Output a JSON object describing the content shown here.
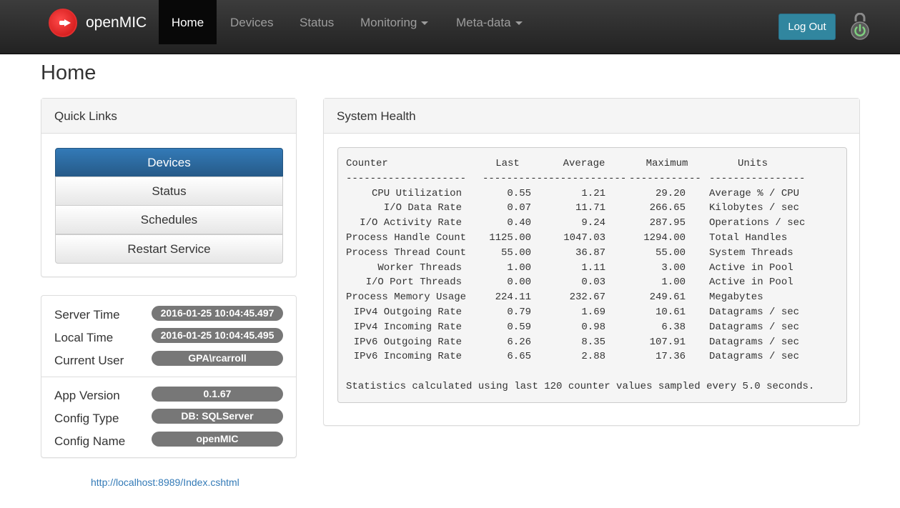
{
  "nav": {
    "brand": "openMIC",
    "items": [
      "Home",
      "Devices",
      "Status",
      "Monitoring",
      "Meta-data"
    ],
    "logout": "Log Out"
  },
  "page": {
    "title": "Home"
  },
  "quick_links": {
    "title": "Quick Links",
    "buttons": [
      "Devices",
      "Status",
      "Schedules",
      "Restart Service"
    ]
  },
  "info": {
    "server_time": {
      "label": "Server Time",
      "value": "2016-01-25 10:04:45.497"
    },
    "local_time": {
      "label": "Local Time",
      "value": "2016-01-25 10:04:45.495"
    },
    "current_user": {
      "label": "Current User",
      "value": "GPA\\rcarroll"
    },
    "app_version": {
      "label": "App Version",
      "value": "0.1.67"
    },
    "config_type": {
      "label": "Config Type",
      "value": "DB: SQLServer"
    },
    "config_name": {
      "label": "Config Name",
      "value": "openMIC"
    }
  },
  "footer": {
    "link": "http://localhost:8989/Index.cshtml"
  },
  "health": {
    "title": "System Health",
    "headers": [
      "Counter",
      "Last",
      "Average",
      "Maximum",
      "Units"
    ],
    "separators": [
      "--------------------",
      "------------",
      "-------------",
      "------------",
      "----------------"
    ],
    "rows": [
      [
        "CPU Utilization",
        "0.55",
        "1.21",
        "29.20",
        "Average % / CPU"
      ],
      [
        "I/O Data Rate",
        "0.07",
        "11.71",
        "266.65",
        "Kilobytes / sec"
      ],
      [
        "I/O Activity Rate",
        "0.40",
        "9.24",
        "287.95",
        "Operations / sec"
      ],
      [
        "Process Handle Count",
        "1125.00",
        "1047.03",
        "1294.00",
        "Total Handles"
      ],
      [
        "Process Thread Count",
        "55.00",
        "36.87",
        "55.00",
        "System Threads"
      ],
      [
        "Worker Threads",
        "1.00",
        "1.11",
        "3.00",
        "Active in Pool"
      ],
      [
        "I/O Port Threads",
        "0.00",
        "0.03",
        "1.00",
        "Active in Pool"
      ],
      [
        "Process Memory Usage",
        "224.11",
        "232.67",
        "249.61",
        "Megabytes"
      ],
      [
        "IPv4 Outgoing Rate",
        "0.79",
        "1.69",
        "10.61",
        "Datagrams / sec"
      ],
      [
        "IPv4 Incoming Rate",
        "0.59",
        "0.98",
        "6.38",
        "Datagrams / sec"
      ],
      [
        "IPv6 Outgoing Rate",
        "6.26",
        "8.35",
        "107.91",
        "Datagrams / sec"
      ],
      [
        "IPv6 Incoming Rate",
        "6.65",
        "2.88",
        "17.36",
        "Datagrams / sec"
      ]
    ],
    "footnote": "Statistics calculated using last 120 counter values sampled every 5.0 seconds."
  },
  "colors": {
    "primary": "#337ab7",
    "navbar": "#222222",
    "badge": "#777777",
    "logout": "#31869f"
  }
}
